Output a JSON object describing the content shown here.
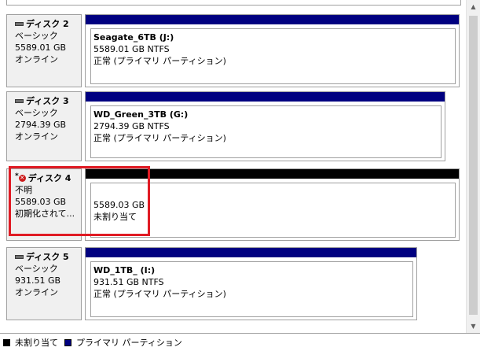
{
  "disks": [
    {
      "name": "ディスク 2",
      "type": "ベーシック",
      "size": "5589.01 GB",
      "status": "オンライン",
      "partition": {
        "name": "Seagate_6TB  (J:)",
        "size_fs": "5589.01 GB NTFS",
        "status": "正常 (プライマリ パーティション)",
        "kind": "primary"
      }
    },
    {
      "name": "ディスク 3",
      "type": "ベーシック",
      "size": "2794.39 GB",
      "status": "オンライン",
      "partition": {
        "name": "WD_Green_3TB  (G:)",
        "size_fs": "2794.39 GB NTFS",
        "status": "正常 (プライマリ パーティション)",
        "kind": "primary"
      }
    },
    {
      "name": "ディスク 4",
      "type": "不明",
      "size": "5589.03 GB",
      "status": "初期化されて...",
      "error_mark": "*",
      "partition": {
        "size_fs": "5589.03 GB",
        "status": "未割り当て",
        "kind": "unallocated"
      }
    },
    {
      "name": "ディスク 5",
      "type": "ベーシック",
      "size": "931.51 GB",
      "status": "オンライン",
      "partition": {
        "name": "WD_1TB_  (I:)",
        "size_fs": "931.51 GB NTFS",
        "status": "正常 (プライマリ パーティション)",
        "kind": "primary"
      }
    }
  ],
  "legend": {
    "unallocated": "未割り当て",
    "primary": "プライマリ パーティション"
  },
  "colors": {
    "primary": "#000080",
    "unallocated": "#000000",
    "highlight": "#e01b24"
  }
}
